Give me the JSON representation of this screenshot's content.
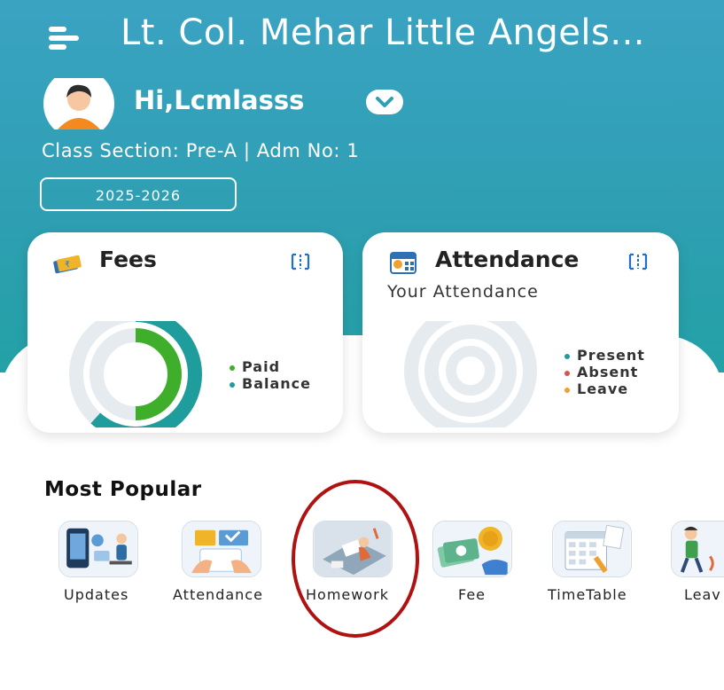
{
  "header": {
    "title": "Lt. Col. Mehar Little Angels...",
    "greeting": "Hi,Lcmlasss",
    "class_info": "Class Section: Pre-A | Adm No: 1",
    "session": "2025-2026"
  },
  "fees_card": {
    "title": "Fees",
    "legend": [
      {
        "label": "Paid",
        "color": "#3fae2a"
      },
      {
        "label": "Balance",
        "color": "#1f9c9c"
      }
    ]
  },
  "attendance_card": {
    "title": "Attendance",
    "subtitle": "Your Attendance",
    "legend": [
      {
        "label": "Present",
        "color": "#1f9c9c"
      },
      {
        "label": "Absent",
        "color": "#d9534f"
      },
      {
        "label": "Leave",
        "color": "#f0a030"
      }
    ]
  },
  "most_popular": {
    "title": "Most Popular",
    "items": [
      {
        "label": "Updates",
        "icon": "updates-icon"
      },
      {
        "label": "Attendance",
        "icon": "attendance-icon"
      },
      {
        "label": "Homework",
        "icon": "homework-icon"
      },
      {
        "label": "Fee",
        "icon": "fee-icon"
      },
      {
        "label": "TimeTable",
        "icon": "timetable-icon"
      },
      {
        "label": "Leav",
        "icon": "leave-icon"
      }
    ]
  },
  "colors": {
    "header_bg": "#2f9fb3",
    "accent_teal": "#1f9c9c",
    "paid_green": "#3fae2a",
    "highlight_red": "#b01212"
  }
}
